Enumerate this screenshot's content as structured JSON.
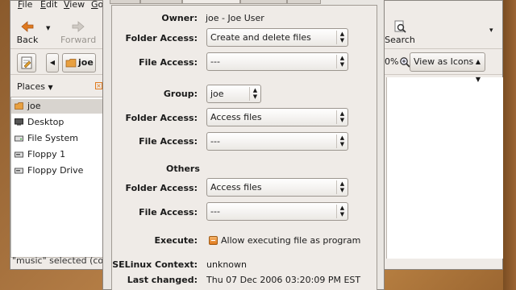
{
  "file_manager": {
    "menu": [
      "File",
      "Edit",
      "View",
      "Go"
    ],
    "toolbar": {
      "back": "Back",
      "forward": "Forward",
      "search": "Search"
    },
    "location": {
      "current": "joe"
    },
    "zoom_label": "0%",
    "view_as": "View as Icons",
    "places": {
      "header": "Places",
      "items": [
        {
          "label": "joe",
          "icon": "home-folder-icon",
          "selected": true
        },
        {
          "label": "Desktop",
          "icon": "desktop-icon",
          "selected": false
        },
        {
          "label": "File System",
          "icon": "drive-icon",
          "selected": false
        },
        {
          "label": "Floppy 1",
          "icon": "floppy-icon",
          "selected": false
        },
        {
          "label": "Floppy Drive",
          "icon": "floppy-icon",
          "selected": false
        }
      ]
    },
    "status": "\"music\" selected (con"
  },
  "properties": {
    "owner": {
      "label": "Owner:",
      "value": "joe - Joe User"
    },
    "owner_folder_access": {
      "label": "Folder Access:",
      "value": "Create and delete files"
    },
    "owner_file_access": {
      "label": "File Access:",
      "value": "---"
    },
    "group": {
      "label": "Group:",
      "value": "joe"
    },
    "group_folder_access": {
      "label": "Folder Access:",
      "value": "Access files"
    },
    "group_file_access": {
      "label": "File Access:",
      "value": "---"
    },
    "others": {
      "label": "Others"
    },
    "others_folder_access": {
      "label": "Folder Access:",
      "value": "Access files"
    },
    "others_file_access": {
      "label": "File Access:",
      "value": "---"
    },
    "execute": {
      "label": "Execute:",
      "checkbox_label": "Allow executing file as program"
    },
    "selinux": {
      "label": "SELinux Context:",
      "value": "unknown"
    },
    "last_changed": {
      "label": "Last changed:",
      "value": "Thu 07 Dec 2006 03:20:09 PM EST"
    }
  },
  "colors": {
    "accent": "#e07a1e",
    "window_bg": "#efebe7"
  }
}
